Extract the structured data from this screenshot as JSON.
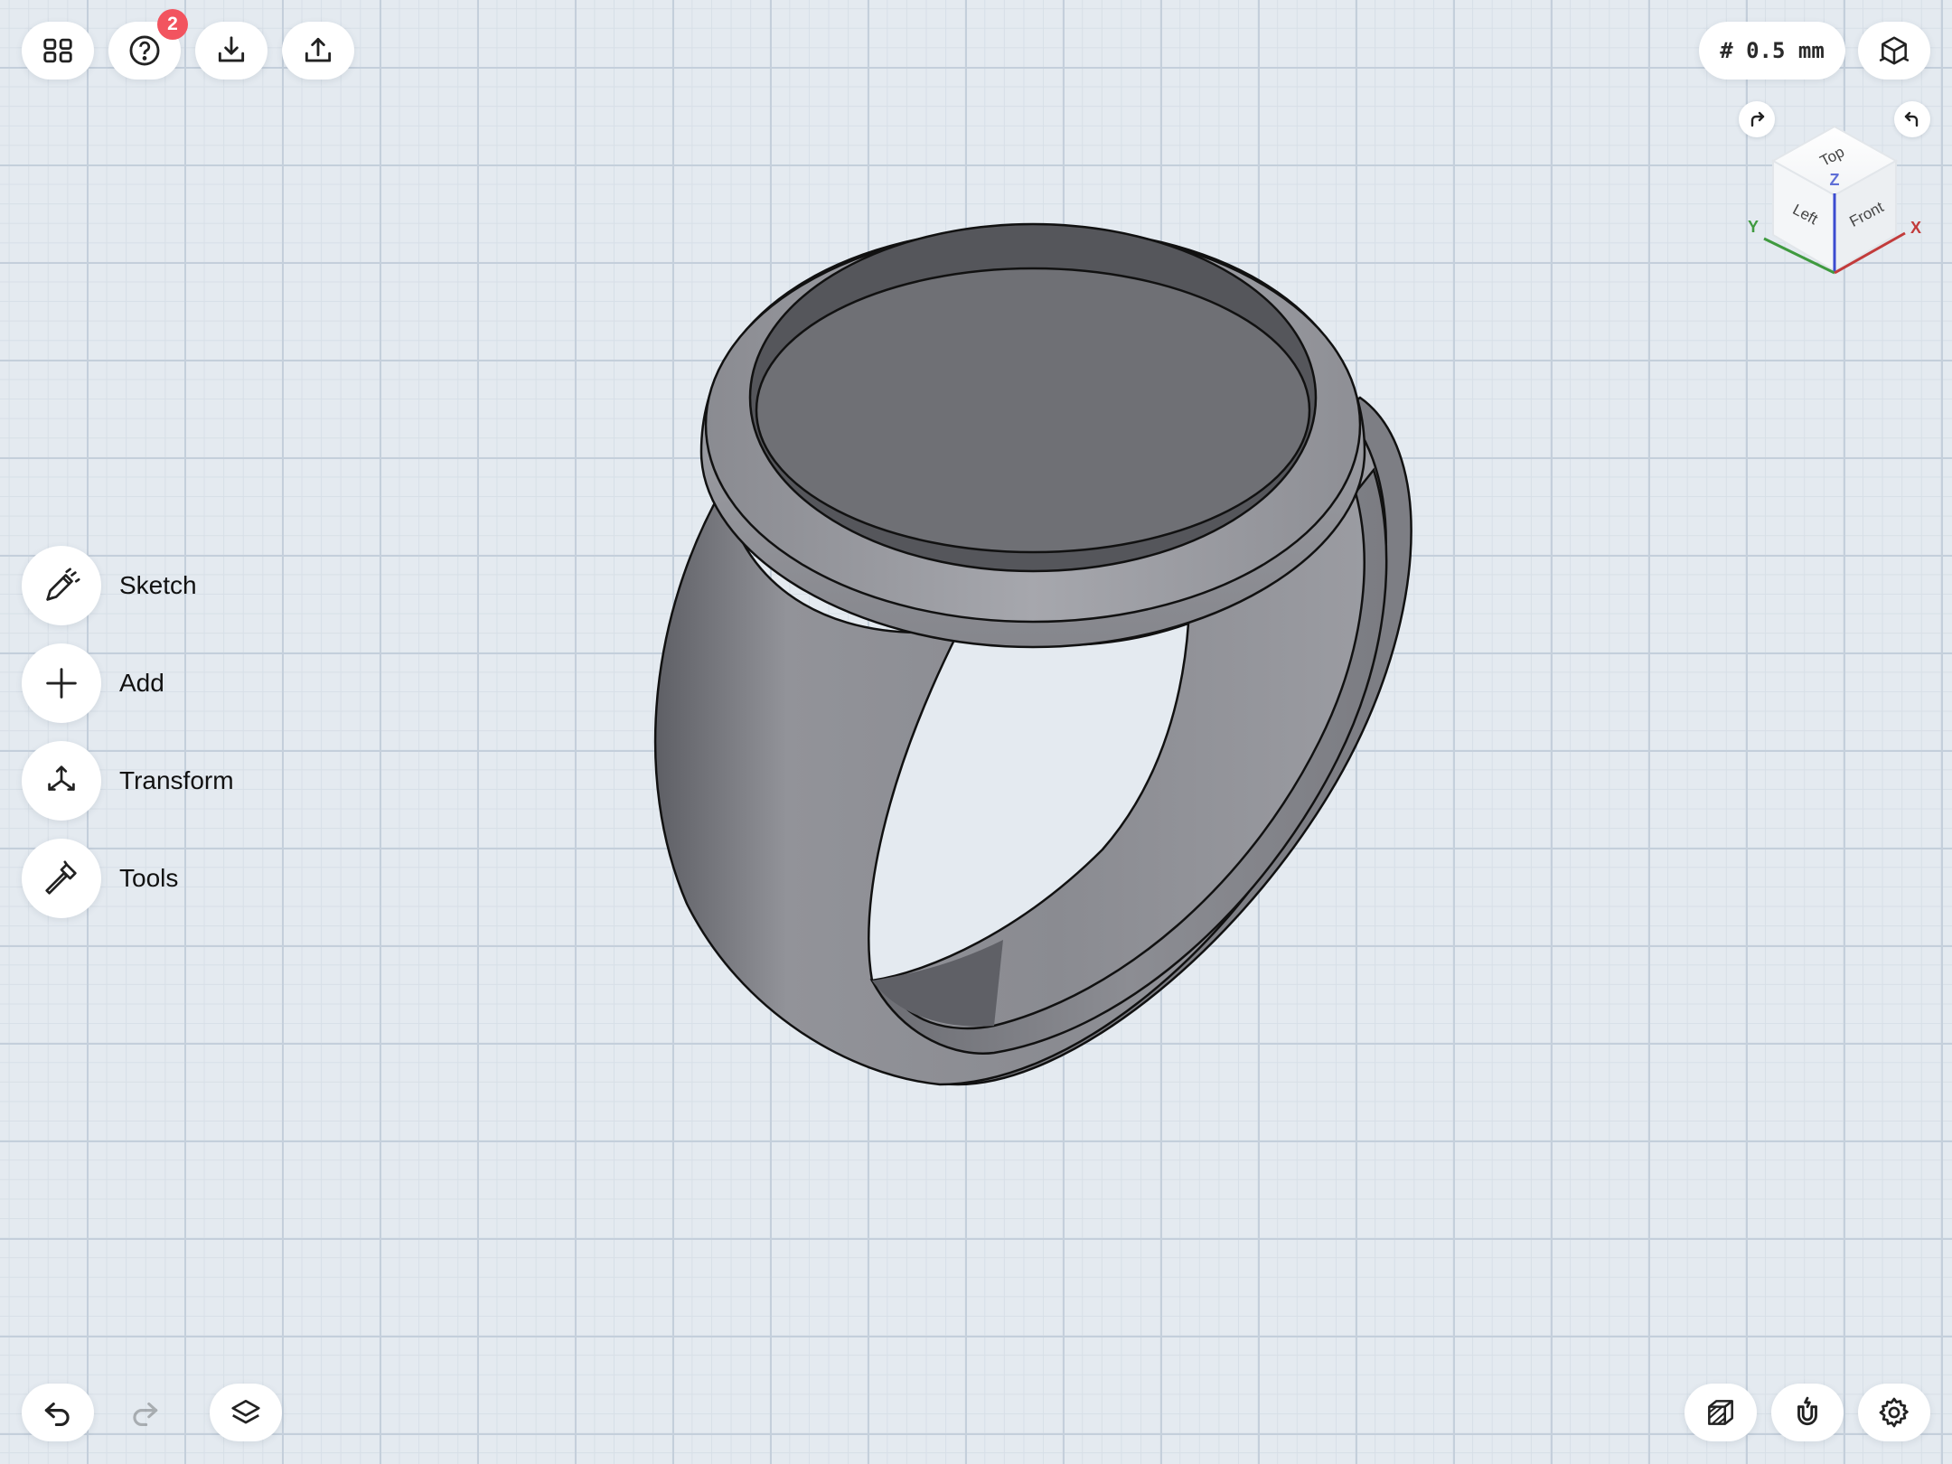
{
  "toolbar": {
    "apps_icon": "grid-icon",
    "help_icon": "question-circle-icon",
    "help_badge": "2",
    "import_icon": "import-icon",
    "export_icon": "export-icon"
  },
  "grid_size": {
    "label": "# 0.5 mm"
  },
  "view_cube": {
    "faces": {
      "top": "Top",
      "left": "Left",
      "front": "Front"
    },
    "axes": {
      "x": "X",
      "y": "Y",
      "z": "Z"
    },
    "axis_colors": {
      "x": "#c23b3b",
      "y": "#3f9a3f",
      "z": "#3b4bd0"
    }
  },
  "sidebar": {
    "items": [
      {
        "label": "Sketch",
        "icon": "pen-icon"
      },
      {
        "label": "Add",
        "icon": "plus-icon"
      },
      {
        "label": "Transform",
        "icon": "transform-arrows-icon"
      },
      {
        "label": "Tools",
        "icon": "hammer-icon"
      }
    ]
  },
  "bottom": {
    "undo_icon": "undo-icon",
    "redo_icon": "redo-icon",
    "layers_icon": "layers-icon",
    "section_icon": "section-view-icon",
    "snap_icon": "magnet-icon",
    "settings_icon": "gear-icon"
  },
  "colors": {
    "model": "#8a8b91",
    "badge": "#f2545f",
    "background": "#e4eaf0"
  }
}
